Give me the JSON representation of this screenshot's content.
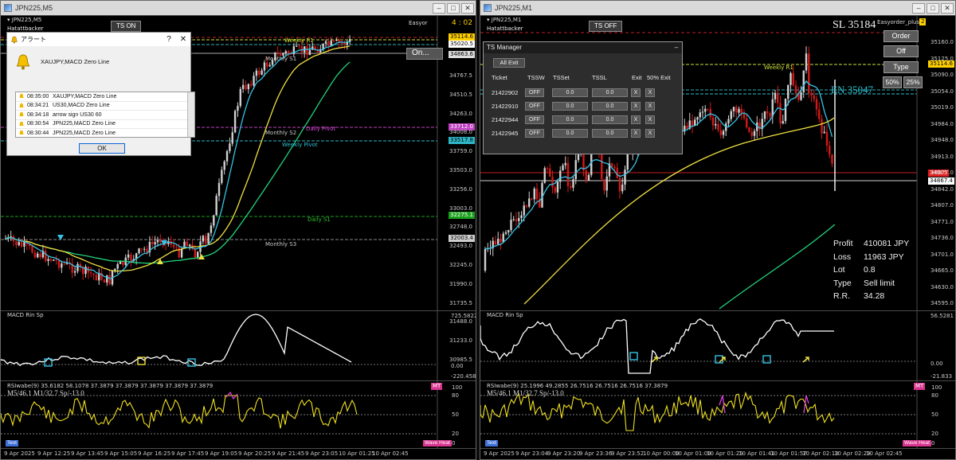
{
  "left": {
    "title": "JPN225,M5",
    "ts_button": "TS ON",
    "easyorder": "Easyor",
    "countdown": "4 : 02",
    "chart_header": "Hatattbacker",
    "on_button": "On...",
    "price_tags": [
      {
        "text": "35114.6",
        "color": "#ffd000",
        "fg": "#000"
      },
      {
        "text": "35020.5",
        "color": "#ffffff",
        "fg": "#000"
      },
      {
        "text": "34863.6",
        "color": "#dddddd",
        "fg": "#000"
      },
      {
        "text": "33712.0",
        "color": "#c040c0",
        "fg": "#fff"
      },
      {
        "text": "33517.8",
        "color": "#2fb7c7",
        "fg": "#000"
      },
      {
        "text": "32275.1",
        "color": "#1ba01b",
        "fg": "#fff"
      },
      {
        "text": "32003.4",
        "color": "#cfcfcf",
        "fg": "#000"
      }
    ],
    "y_labels": [
      "34767.5",
      "34510.5",
      "34263.0",
      "34008.0",
      "33759.0",
      "33503.0",
      "33256.0",
      "33003.0",
      "32748.0",
      "32493.0",
      "32245.0",
      "31990.0",
      "31735.5",
      "31488.0",
      "31233.0",
      "30985.5"
    ],
    "level_labels": [
      {
        "text": "Weekly R1",
        "color": "#cde03a"
      },
      {
        "text": "Monthly S1",
        "color": "#c8c8c8"
      },
      {
        "text": "Monthly S2",
        "color": "#c8c8c8"
      },
      {
        "text": "Daily Pivot",
        "color": "#d049d0"
      },
      {
        "text": "Weekly Pivot",
        "color": "#2fc2d2"
      },
      {
        "text": "Daily S1",
        "color": "#2fbf2f"
      },
      {
        "text": "Monthly S3",
        "color": "#c8c8c8"
      }
    ],
    "x_labels": [
      "9 Apr 2025",
      "9 Apr 12:25",
      "9 Apr 13:45",
      "9 Apr 15:05",
      "9 Apr 16:25",
      "9 Apr 17:45",
      "9 Apr 19:05",
      "9 Apr 20:25",
      "9 Apr 21:45",
      "9 Apr 23:05",
      "10 Apr 01:25",
      "10 Apr 02:45"
    ],
    "macd_label": "MACD Rin Sp",
    "macd_levels": [
      "725.5822",
      "0.00",
      "-220.4589"
    ],
    "rsi_label": "RSIwabe(9) 35.6182 58.1078 37.3879 37.3879 37.3879 37.3879 37.3879",
    "rsi_extra": "M5/46.1    M1/32.7    Sp/-13.0",
    "rsi_levels": [
      "100",
      "80",
      "50",
      "20",
      "0"
    ],
    "badge_text": "Text",
    "badge_wave": "Wave Heat",
    "rsi_tag": "MT"
  },
  "alert": {
    "title": "アラート",
    "help": "?",
    "close": "✕",
    "message": "XAUJPY,MACD Zero Line",
    "rows": [
      {
        "time": "08:35:00",
        "text": "XAUJPY,MACD Zero Line"
      },
      {
        "time": "08:34:21",
        "text": "US30,MACD Zero Line"
      },
      {
        "time": "08:34:18",
        "text": "arrow sign US30 60"
      },
      {
        "time": "08:30:54",
        "text": "JPN225,MACD Zero Line"
      },
      {
        "time": "08:30:44",
        "text": "JPN225,MACD Zero Line"
      }
    ],
    "ok": "OK"
  },
  "right": {
    "title": "JPN225,M1",
    "ts_button": "TS OFF",
    "easyorder": "Easyorder_plus",
    "badge_num": "2",
    "chart_header": "Hatattbacker",
    "sl_text": "SL  35184",
    "en_text": "EN  35047",
    "price_tags": [
      {
        "text": "35114.6",
        "color": "#ffd000",
        "fg": "#000"
      },
      {
        "text": "34867.4",
        "color": "#ffffff",
        "fg": "#000"
      },
      {
        "text": "34905",
        "color": "#e02020",
        "fg": "#fff"
      }
    ],
    "y_labels": [
      "35160.0",
      "35125.0",
      "35090.0",
      "35054.0",
      "35019.0",
      "34984.0",
      "34948.0",
      "34913.0",
      "34877.0",
      "34842.0",
      "34807.0",
      "34771.0",
      "34736.0",
      "34701.0",
      "34665.0",
      "34630.0",
      "34595.0"
    ],
    "weekly_r1": "Weekly R1",
    "x_labels": [
      "9 Apr 2025",
      "9 Apr 23:04",
      "9 Apr 23:20",
      "9 Apr 23:36",
      "9 Apr 23:52",
      "10 Apr 00:09",
      "10 Apr 01:09",
      "10 Apr 01:25",
      "10 Apr 01:41",
      "10 Apr 01:57",
      "10 Apr 02:13",
      "10 Apr 02:29",
      "10 Apr 02:45"
    ],
    "buttons": {
      "order": "Order",
      "off": "Off",
      "type": "Type",
      "p50": "50%",
      "p25": "25%"
    },
    "stats": [
      {
        "k": "Profit",
        "v": "410081 JPY"
      },
      {
        "k": "Loss",
        "v": "11963 JPY"
      },
      {
        "k": "Lot",
        "v": "0.8"
      },
      {
        "k": "Type",
        "v": "Sell limit"
      },
      {
        "k": "R.R.",
        "v": "34.28"
      }
    ],
    "macd_label": "MACD Rin Sp",
    "macd_levels": [
      "56.5281",
      "0.00",
      "-21.833"
    ],
    "rsi_label": "RSIwabe(9) 25.1996 49.2855 26.7516 26.7516 26.7516 37.3879",
    "rsi_extra": "M5/46.1    M1/32.7    Sp/-13.0",
    "rsi_levels": [
      "100",
      "80",
      "50",
      "20",
      "0"
    ],
    "badge_text": "Text",
    "badge_wave": "Wave Heat",
    "rsi_tag": "MT"
  },
  "ts_manager": {
    "title": "TS Manager",
    "minimize": "–",
    "all_exit": "All Exit",
    "headers": [
      "Ticket",
      "TSSW",
      "TSSet",
      "TSSL",
      "Exit",
      "50% Exit"
    ],
    "rows": [
      {
        "ticket": "21422902",
        "tssw": "OFF",
        "tsset": "0.0",
        "tssl": "0.0",
        "exit": "X",
        "half": "X"
      },
      {
        "ticket": "21422910",
        "tssw": "OFF",
        "tsset": "0.0",
        "tssl": "0.0",
        "exit": "X",
        "half": "X"
      },
      {
        "ticket": "21422944",
        "tssw": "OFF",
        "tsset": "0.0",
        "tssl": "0.0",
        "exit": "X",
        "half": "X"
      },
      {
        "ticket": "21422945",
        "tssw": "OFF",
        "tsset": "0.0",
        "tssl": "0.0",
        "exit": "X",
        "half": "X"
      }
    ]
  },
  "colors": {
    "bull": "#d0d0d0",
    "bear": "#d21a1a",
    "ma_cyan": "#37c3e6",
    "ma_yellow": "#f0e040",
    "ma_green": "#22d37a",
    "rsi_yellow": "#f0e020",
    "rsi_magenta": "#e040e0"
  },
  "window_buttons": {
    "min": "–",
    "max": "□",
    "close": "✕"
  }
}
